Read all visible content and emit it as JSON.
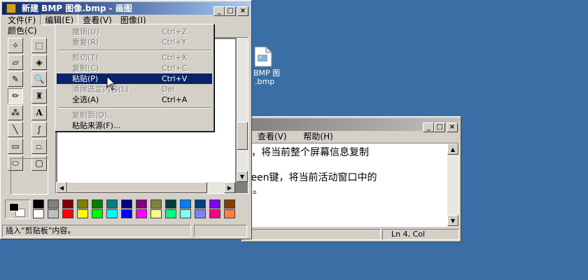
{
  "desktop": {
    "icon_label_1": "BMP 图",
    "icon_label_2": ".bmp"
  },
  "paint": {
    "title": "新建 BMP 图像.bmp - 画图",
    "menu": {
      "file": "文件(F)",
      "edit": "编辑(E)",
      "view": "查看(V)",
      "image": "图像(I)",
      "colors": "颜色(C)"
    },
    "status": "插入“剪贴板”内容。",
    "palette": [
      "#000000",
      "#808080",
      "#800000",
      "#808000",
      "#008000",
      "#008080",
      "#000080",
      "#800080",
      "#808040",
      "#004040",
      "#0080ff",
      "#004080",
      "#8000ff",
      "#804000",
      "#ffffff",
      "#c0c0c0",
      "#ff0000",
      "#ffff00",
      "#00ff00",
      "#00ffff",
      "#0000ff",
      "#ff00ff",
      "#ffff80",
      "#00ff80",
      "#80ffff",
      "#8080ff",
      "#ff0080",
      "#ff8040"
    ],
    "primary_color": "#000000",
    "secondary_color": "#ffffff"
  },
  "edit_menu": {
    "items": [
      {
        "label": "撤销(U)",
        "shortcut": "Ctrl+Z",
        "disabled": true
      },
      {
        "label": "重复(R)",
        "shortcut": "Ctrl+Y",
        "disabled": true
      },
      {
        "label": "剪切(T)",
        "shortcut": "Ctrl+X",
        "disabled": true
      },
      {
        "label": "复制(C)",
        "shortcut": "Ctrl+C",
        "disabled": true
      },
      {
        "label": "粘贴(P)",
        "shortcut": "Ctrl+V",
        "disabled": false,
        "highlighted": true
      },
      {
        "label": "清除选定内容(L)",
        "shortcut": "Del",
        "disabled": true
      },
      {
        "label": "全选(A)",
        "shortcut": "Ctrl+A",
        "disabled": false
      },
      {
        "label": "复制到(O)...",
        "shortcut": "",
        "disabled": true
      },
      {
        "label": "粘贴来源(F)...",
        "shortcut": "",
        "disabled": false
      }
    ]
  },
  "notepad": {
    "menu": {
      "view": "查看(V)",
      "help": "帮助(H)"
    },
    "lines": [
      "，将当前整个屏幕信息复制",
      "reen键，将当前活动窗口中的",
      "。"
    ],
    "status": "Ln 4, Col"
  }
}
